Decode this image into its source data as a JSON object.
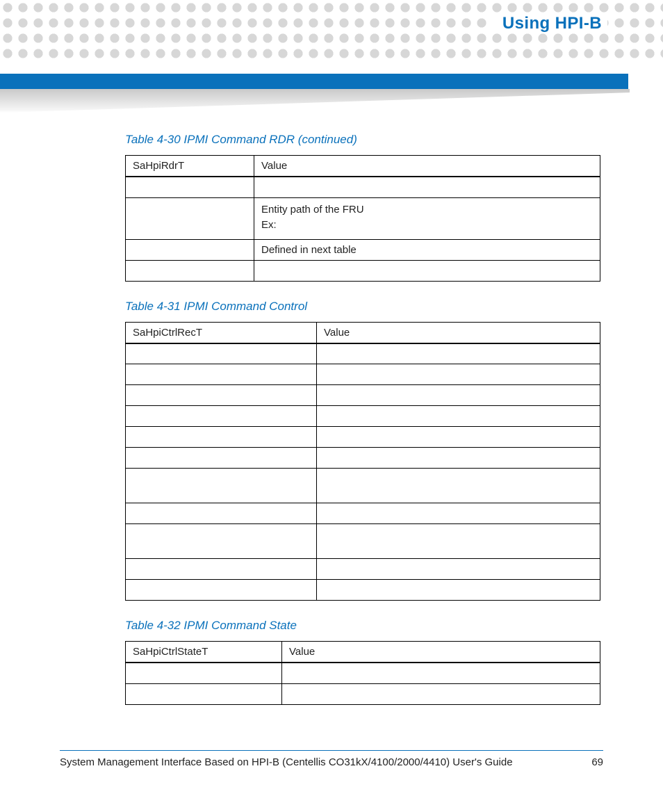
{
  "header": {
    "title": "Using HPI-B"
  },
  "tables": {
    "t430": {
      "caption": "Table 4-30 IPMI Command RDR (continued)",
      "head": [
        "SaHpiRdrT",
        "Value"
      ],
      "rows": [
        [
          "",
          ""
        ],
        [
          "",
          "Entity path of the FRU\nEx:"
        ],
        [
          "",
          "Defined in next table"
        ],
        [
          "",
          ""
        ]
      ]
    },
    "t431": {
      "caption": "Table 4-31 IPMI Command Control",
      "head": [
        "SaHpiCtrlRecT",
        "Value"
      ],
      "rows": [
        [
          "",
          ""
        ],
        [
          "",
          ""
        ],
        [
          "",
          ""
        ],
        [
          "",
          ""
        ],
        [
          "",
          ""
        ],
        [
          "",
          ""
        ],
        [
          "",
          ""
        ],
        [
          "",
          ""
        ],
        [
          "",
          ""
        ],
        [
          "",
          ""
        ],
        [
          "",
          ""
        ]
      ]
    },
    "t432": {
      "caption": "Table 4-32 IPMI Command State",
      "head": [
        "SaHpiCtrlStateT",
        "Value"
      ],
      "rows": [
        [
          "",
          ""
        ],
        [
          "",
          ""
        ]
      ]
    }
  },
  "footer": {
    "text": "System Management Interface Based on HPI-B (Centellis CO31kX/4100/2000/4410) User's Guide",
    "page": "69"
  }
}
